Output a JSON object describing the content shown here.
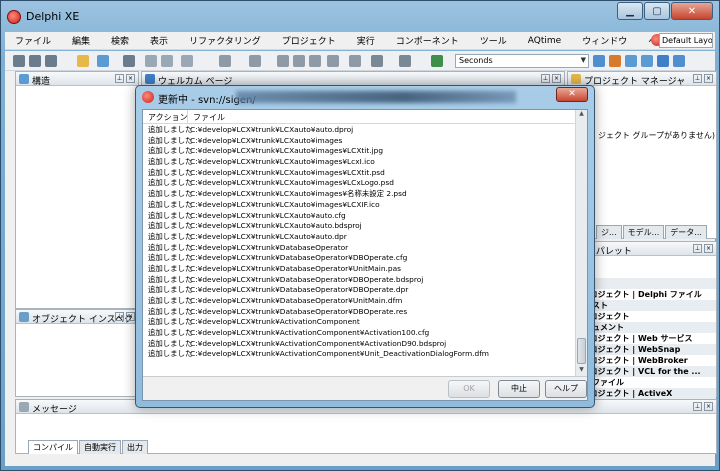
{
  "app": {
    "title": "Delphi XE"
  },
  "window_controls": {
    "minimize": "▁",
    "maximize": "▢",
    "close": "✕"
  },
  "menu": [
    "ファイル",
    "編集",
    "検索",
    "表示",
    "リファクタリング",
    "プロジェクト",
    "実行",
    "コンポーネント",
    "ツール",
    "AQtime",
    "ウィンドウ",
    "ヘルプ"
  ],
  "layout": {
    "selected": "Default Layout"
  },
  "toolbar": {
    "combo_value": "Seconds",
    "combo_arrow": "▼"
  },
  "panes": {
    "structure": "構造",
    "welcome": "ウェルカム ページ",
    "project_manager": "プロジェクト マネージャ",
    "project_manager_text": "ジェクト グループがありません)",
    "object_inspector": "オブジェクト インスペクタ",
    "messages": "メッセージ",
    "tool_palette": "ル パレット",
    "right_tabs": [
      "ジ...",
      "モデル...",
      "データ..."
    ],
    "palette_items": [
      "ling",
      "i プロジェクト | Delphi ファイル",
      "トテスト",
      "i プロジェクト",
      "ドキュメント",
      "i プロジェクト | Web サービス",
      "i プロジェクト | WebSnap",
      "i プロジェクト | WebBroker",
      "i プロジェクト | VCL for the ...",
      "他のファイル",
      "i プロジェクト | ActiveX"
    ],
    "bottom_tabs": [
      "コンパイル",
      "自動実行",
      "出力"
    ]
  },
  "dialog": {
    "title": "更新中 - svn://sigen/",
    "close_label": "✕",
    "columns": {
      "action": "アクション",
      "file": "ファイル"
    },
    "rows": [
      {
        "action": "追加しました",
        "file": "C:¥develop¥LCX¥trunk¥LCXauto¥auto.dproj"
      },
      {
        "action": "追加しました",
        "file": "C:¥develop¥LCX¥trunk¥LCXauto¥images"
      },
      {
        "action": "追加しました",
        "file": "C:¥develop¥LCX¥trunk¥LCXauto¥images¥LCXtit.jpg"
      },
      {
        "action": "追加しました",
        "file": "C:¥develop¥LCX¥trunk¥LCXauto¥images¥LcxI.ico"
      },
      {
        "action": "追加しました",
        "file": "C:¥develop¥LCX¥trunk¥LCXauto¥images¥LCXtit.psd"
      },
      {
        "action": "追加しました",
        "file": "C:¥develop¥LCX¥trunk¥LCXauto¥images¥LCxLogo.psd"
      },
      {
        "action": "追加しました",
        "file": "C:¥develop¥LCX¥trunk¥LCXauto¥images¥名称未設定 2.psd"
      },
      {
        "action": "追加しました",
        "file": "C:¥develop¥LCX¥trunk¥LCXauto¥images¥LCXIF.ico"
      },
      {
        "action": "追加しました",
        "file": "C:¥develop¥LCX¥trunk¥LCXauto¥auto.cfg"
      },
      {
        "action": "追加しました",
        "file": "C:¥develop¥LCX¥trunk¥LCXauto¥auto.bdsproj"
      },
      {
        "action": "追加しました",
        "file": "C:¥develop¥LCX¥trunk¥LCXauto¥auto.dpr"
      },
      {
        "action": "追加しました",
        "file": "C:¥develop¥LCX¥trunk¥DatabaseOperator"
      },
      {
        "action": "追加しました",
        "file": "C:¥develop¥LCX¥trunk¥DatabaseOperator¥DBOperate.cfg"
      },
      {
        "action": "追加しました",
        "file": "C:¥develop¥LCX¥trunk¥DatabaseOperator¥UnitMain.pas"
      },
      {
        "action": "追加しました",
        "file": "C:¥develop¥LCX¥trunk¥DatabaseOperator¥DBOperate.bdsproj"
      },
      {
        "action": "追加しました",
        "file": "C:¥develop¥LCX¥trunk¥DatabaseOperator¥DBOperate.dpr"
      },
      {
        "action": "追加しました",
        "file": "C:¥develop¥LCX¥trunk¥DatabaseOperator¥UnitMain.dfm"
      },
      {
        "action": "追加しました",
        "file": "C:¥develop¥LCX¥trunk¥DatabaseOperator¥DBOperate.res"
      },
      {
        "action": "追加しました",
        "file": "C:¥develop¥LCX¥trunk¥ActivationComponent"
      },
      {
        "action": "追加しました",
        "file": "C:¥develop¥LCX¥trunk¥ActivationComponent¥Activation100.cfg"
      },
      {
        "action": "追加しました",
        "file": "C:¥develop¥LCX¥trunk¥ActivationComponent¥ActivationD90.bdsproj"
      },
      {
        "action": "追加しました",
        "file": "C:¥develop¥LCX¥trunk¥ActivationComponent¥Unit_DeactivationDialogForm.dfm"
      }
    ],
    "buttons": {
      "ok": "OK",
      "abort": "中止",
      "help": "ヘルプ"
    }
  },
  "colors": {
    "accent": "#c8201a",
    "frame": "#7fb0d4"
  }
}
